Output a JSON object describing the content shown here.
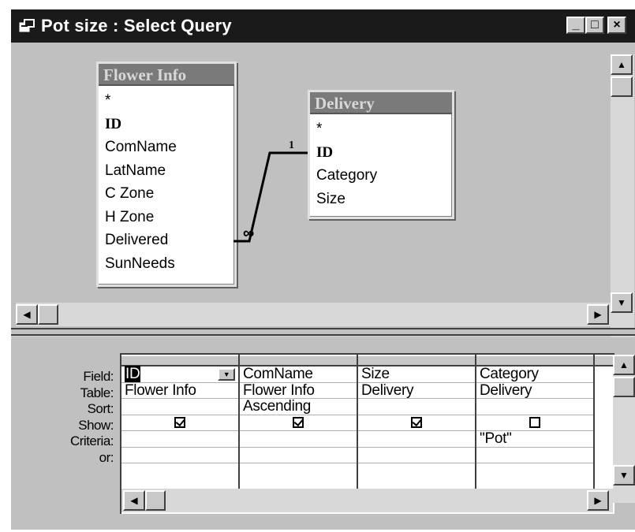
{
  "window": {
    "title": "Pot size : Select Query",
    "controls": {
      "minimize": "_",
      "maximize": "□",
      "close": "×"
    }
  },
  "tables": [
    {
      "name": "Flower Info",
      "fields": [
        "*",
        "ID",
        "ComName",
        "LatName",
        "C Zone",
        "H Zone",
        "Delivered",
        "SunNeeds"
      ]
    },
    {
      "name": "Delivery",
      "fields": [
        "*",
        "ID",
        "Category",
        "Size"
      ]
    }
  ],
  "relationship": {
    "one_label": "1",
    "many_label": "∞"
  },
  "grid": {
    "row_labels": [
      "Field:",
      "Table:",
      "Sort:",
      "Show:",
      "Criteria:",
      "or:"
    ],
    "columns": [
      {
        "field": "ID",
        "table": "Flower Info",
        "sort": "",
        "show": true,
        "criteria": "",
        "or": ""
      },
      {
        "field": "ComName",
        "table": "Flower Info",
        "sort": "Ascending",
        "show": true,
        "criteria": "",
        "or": ""
      },
      {
        "field": "Size",
        "table": "Delivery",
        "sort": "",
        "show": true,
        "criteria": "",
        "or": ""
      },
      {
        "field": "Category",
        "table": "Delivery",
        "sort": "",
        "show": false,
        "criteria": "\"Pot\"",
        "or": ""
      }
    ]
  },
  "icons": [
    "query-window-icon",
    "dropdown-arrow-icon",
    "scroll-up-icon",
    "scroll-down-icon",
    "scroll-left-icon",
    "scroll-right-icon",
    "checkbox-icon"
  ]
}
